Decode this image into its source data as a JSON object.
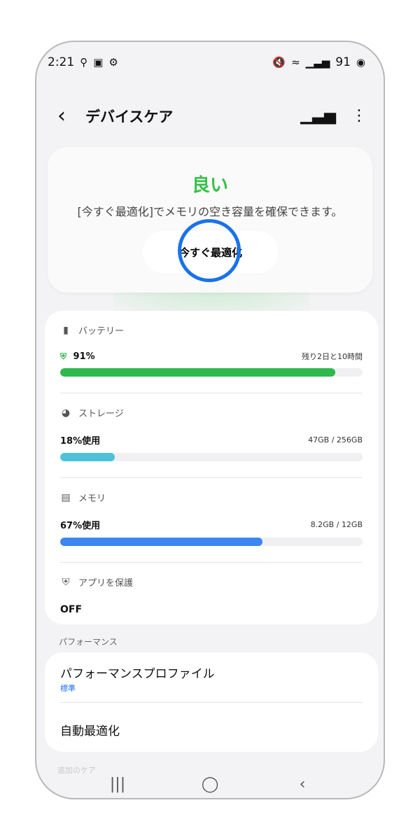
{
  "status_bar": {
    "time": "2:21",
    "battery": "91"
  },
  "header": {
    "title": "デバイスケア"
  },
  "status_card": {
    "status": "良い",
    "description": "[今すぐ最適化]でメモリの空き容量を確保できます。",
    "button_label": "今すぐ最適化",
    "status_color": "#38c14a"
  },
  "metrics": [
    {
      "label": "バッテリー",
      "value": "91%",
      "detail": "残り2日と10時間",
      "level": 0.91,
      "color": "#2fb84e"
    },
    {
      "label": "ストレージ",
      "value": "18%使用",
      "detail": "47GB / 256GB",
      "level": 0.18,
      "color": "#4cc2d9"
    },
    {
      "label": "メモリ",
      "value": "67%使用",
      "detail": "8.2GB / 12GB",
      "level": 0.67,
      "color": "#3b86f0"
    }
  ],
  "protect": {
    "label": "アプリを保護",
    "value": "OFF"
  },
  "performance": {
    "section_label": "パフォーマンス",
    "items": [
      {
        "title": "パフォーマンスプロファイル",
        "subtitle": "標準"
      },
      {
        "title": "自動最適化"
      }
    ]
  },
  "additional_care_label": "追加のケア",
  "icons": {
    "back": "chevron-left-icon",
    "signal_bars": "signal-bars-icon",
    "more": "more-vert-icon"
  }
}
